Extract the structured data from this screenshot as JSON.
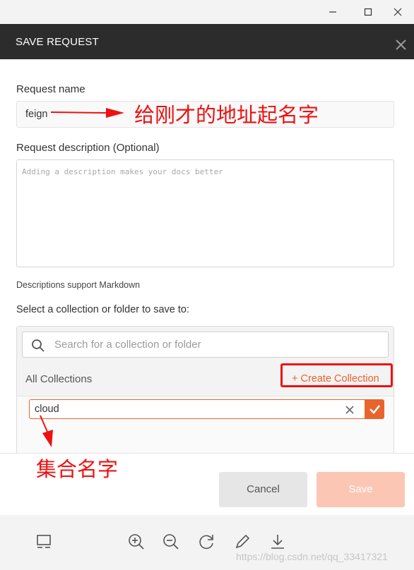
{
  "window": {
    "controls": [
      "minimize",
      "maximize",
      "close"
    ]
  },
  "modal": {
    "title": "SAVE REQUEST",
    "close_icon": "close-icon"
  },
  "form": {
    "name_label": "Request name",
    "name_value": "feign",
    "description_label": "Request description (Optional)",
    "description_placeholder": "Adding a description makes your docs better",
    "markdown_note": "Descriptions support Markdown",
    "collection_label": "Select a collection or folder to save to:"
  },
  "collections": {
    "search_placeholder": "Search for a collection or folder",
    "all_label": "All Collections",
    "create_label": "+ Create Collection",
    "new_collection_value": "cloud"
  },
  "footer": {
    "cancel_label": "Cancel",
    "save_label": "Save"
  },
  "toolbar": {
    "icons": [
      "layout-icon",
      "zoom-in-icon",
      "zoom-out-icon",
      "rotate-icon",
      "edit-icon",
      "download-icon"
    ]
  },
  "annotations": {
    "name_note": "给刚才的地址起名字",
    "collection_note": "集合名字"
  },
  "watermark": "https://blog.csdn.net/qq_33417321",
  "colors": {
    "accent": "#e8642d",
    "header_bg": "#2c2c2c",
    "annotation_red": "#ee1111",
    "save_disabled": "#fbc6b4"
  }
}
